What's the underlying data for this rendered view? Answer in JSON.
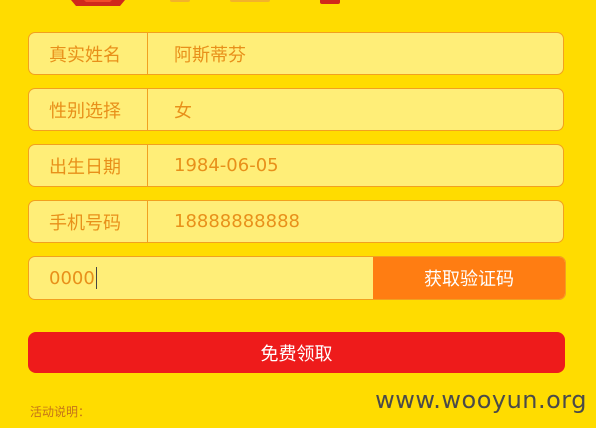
{
  "form": {
    "fields": [
      {
        "label": "真实姓名",
        "value": "阿斯蒂芬"
      },
      {
        "label": "性别选择",
        "value": "女"
      },
      {
        "label": "出生日期",
        "value": "1984-06-05"
      },
      {
        "label": "手机号码",
        "value": "18888888888"
      }
    ],
    "code_value": "0000",
    "code_button": "获取验证码",
    "submit_button": "免费领取"
  },
  "note": "活动说明：",
  "watermark": "www.wooyun.org",
  "colors": {
    "background": "#ffdc00",
    "field_bg": "#ffee78",
    "field_border": "#f2a01f",
    "text": "#e8901a",
    "code_button": "#ff7d12",
    "submit_button": "#ee1b1b"
  }
}
